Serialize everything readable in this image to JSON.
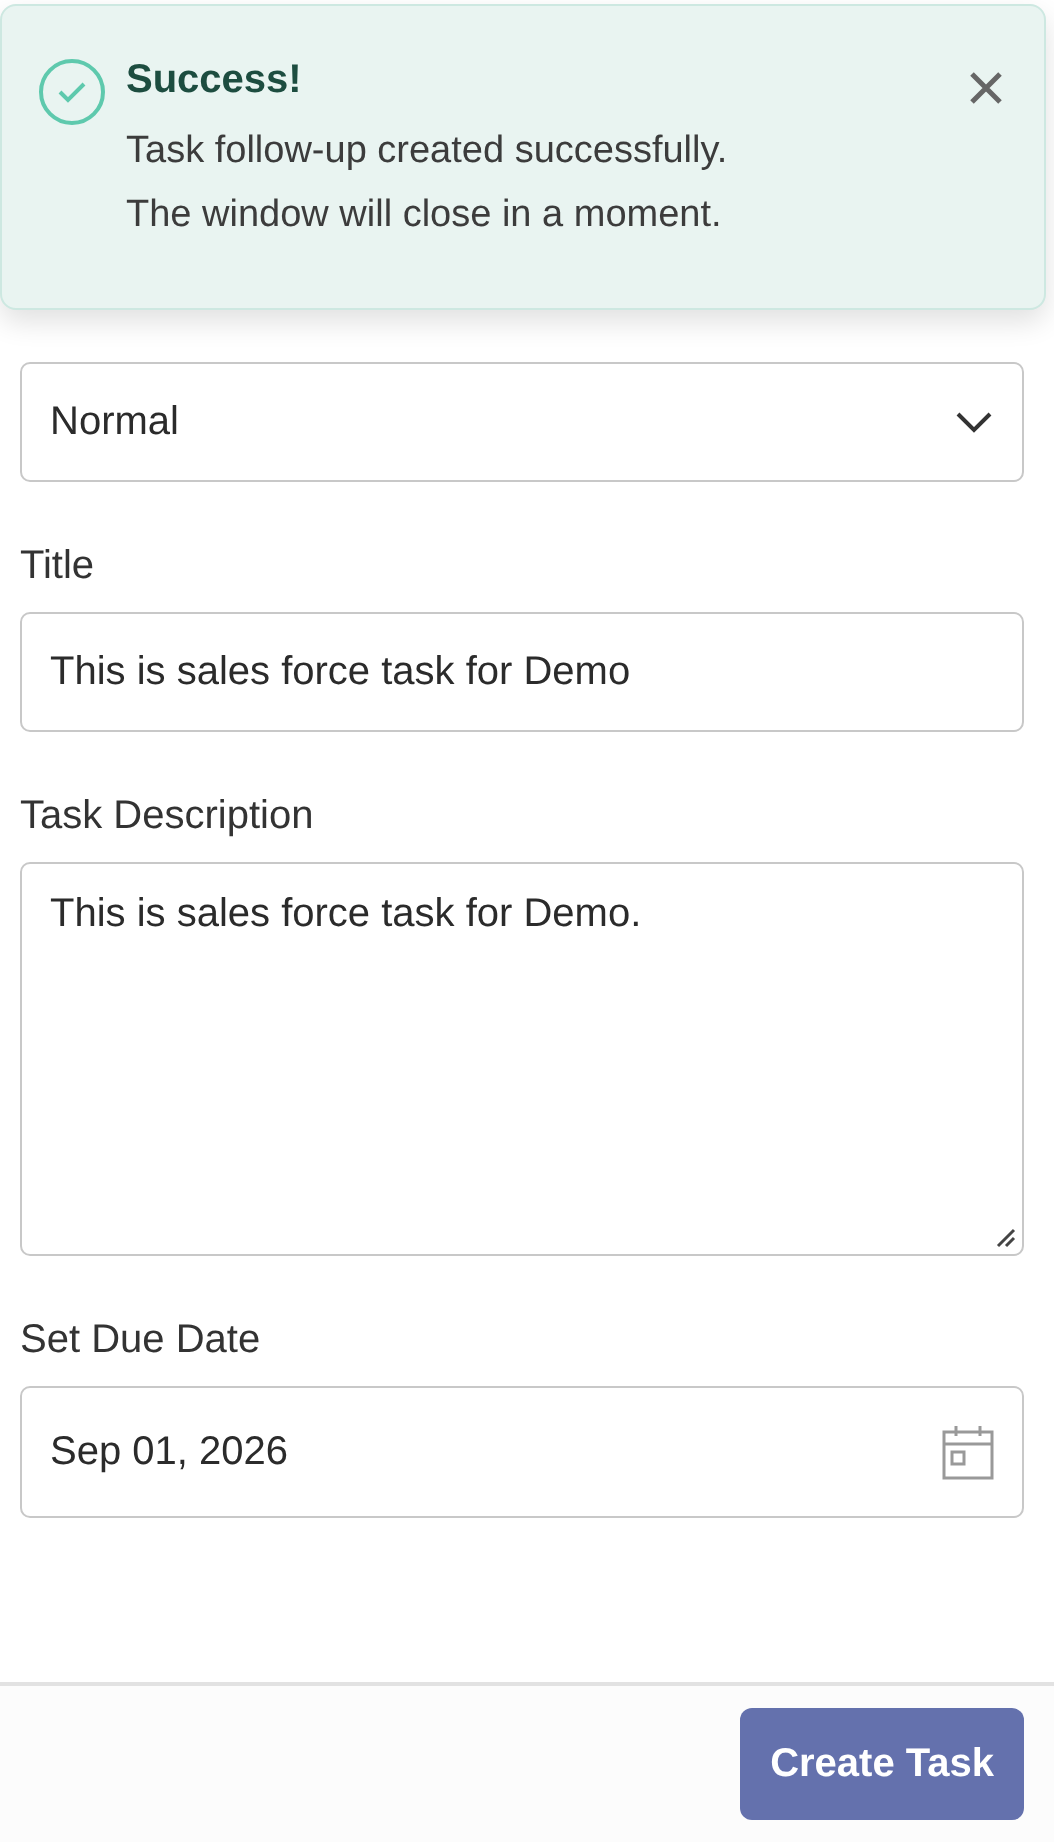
{
  "toast": {
    "title": "Success!",
    "lines": [
      "Task follow-up created successfully.",
      "The window will close in a moment."
    ]
  },
  "fields": [
    {
      "kind": "select",
      "value": "Normal"
    },
    {
      "kind": "text",
      "label": "Title",
      "value": "This is sales force task for Demo"
    },
    {
      "kind": "textarea",
      "label": "Task Description",
      "value": "This is sales force task for Demo."
    },
    {
      "kind": "date",
      "label": "Set Due Date",
      "value": "Sep 01, 2026"
    }
  ],
  "submit": {
    "label": "Create Task"
  }
}
